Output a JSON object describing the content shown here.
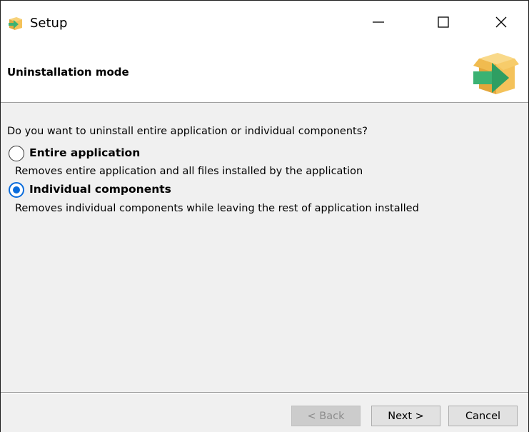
{
  "window": {
    "title": "Setup",
    "minimize_icon": "minimize-icon",
    "maximize_icon": "maximize-icon",
    "close_icon": "close-icon"
  },
  "header": {
    "title": "Uninstallation mode",
    "icon": "setup-box-arrow-icon"
  },
  "content": {
    "question": "Do you want to uninstall entire application or individual components?",
    "options": [
      {
        "label": "Entire application",
        "description": "Removes entire application and all files installed by the application",
        "selected": false
      },
      {
        "label": "Individual components",
        "description": "Removes individual components while leaving the rest of application installed",
        "selected": true
      }
    ]
  },
  "footer": {
    "back_label": "< Back",
    "back_enabled": false,
    "next_label": "Next >",
    "cancel_label": "Cancel"
  },
  "colors": {
    "accent": "#0a6cdc",
    "box": "#f4c25a",
    "arrow": "#3bb273"
  }
}
